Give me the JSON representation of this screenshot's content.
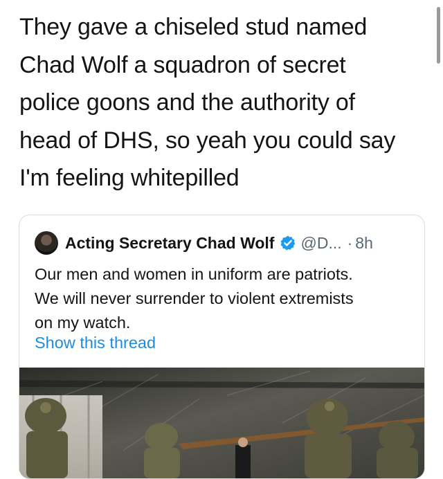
{
  "main_tweet": {
    "lines": [
      "They gave a chiseled stud named",
      "Chad Wolf a squadron of secret",
      "police goons and the authority of",
      "head of DHS, so yeah you could say",
      "I'm feeling whitepilled"
    ]
  },
  "quoted_tweet": {
    "author": "Acting Secretary Chad Wolf",
    "handle": "@D...",
    "separator": "·",
    "time": "8h",
    "body_lines": [
      "Our men and women in uniform are patriots.",
      "We will never surrender to violent extremists",
      "on my watch."
    ],
    "show_thread": "Show this thread",
    "verified_icon": "verified-badge-icon",
    "media_description_icon": "photo-officers-in-tactical-gear"
  },
  "colors": {
    "link": "#1d8ce0",
    "verified": "#1d9bf0",
    "secondary_text": "#5b6670",
    "card_border": "#d7dde2"
  }
}
